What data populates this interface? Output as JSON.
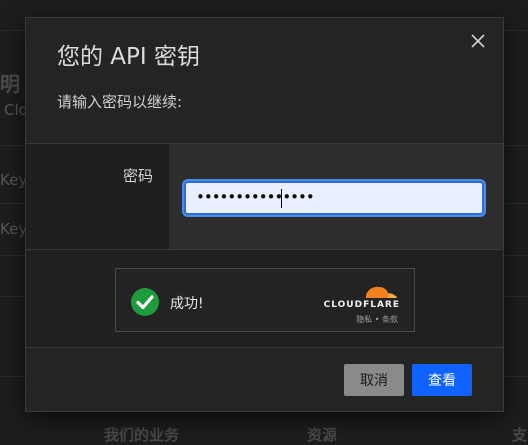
{
  "background": {
    "heading_fragment": "明",
    "text_cl": "Clo",
    "text_key1": "Key",
    "text_key2": "Key",
    "bottom_1": "我们的业务",
    "bottom_2": "资源",
    "bottom_3": "支"
  },
  "modal": {
    "title": "您的 API 密钥",
    "subtitle": "请输入密码以继续:",
    "password_label": "密码",
    "password_value": "•••••••••••••••",
    "captcha": {
      "status_text": "成功!",
      "brand": "CLOUDFLARE",
      "links": "隐私 • 条款",
      "brand_color": "#f48120"
    },
    "buttons": {
      "cancel": "取消",
      "view": "查看"
    },
    "accent_color": "#0f62fe"
  }
}
